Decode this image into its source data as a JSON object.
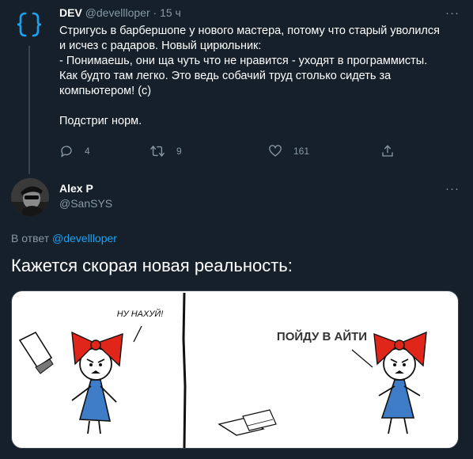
{
  "tweet": {
    "author_name": "DEV",
    "author_handle": "@devellloper",
    "separator": "·",
    "time": "15 ч",
    "more": "···",
    "lines": [
      "Стригусь в барбершопе у нового мастера, потому что старый уволился",
      "и исчез с радаров. Новый цирюльник:",
      "- Понимаешь, они ща чуть что не нравится - уходят в программисты.",
      "Как будто там легко. Это ведь собачий труд столько сидеть за",
      "компьютером! (с)",
      "",
      "Подстриг норм."
    ],
    "actions": {
      "reply_count": "4",
      "retweet_count": "9",
      "like_count": "161"
    }
  },
  "reply": {
    "author_name": "Alex P",
    "author_handle": "@SanSYS",
    "more": "···",
    "reply_to_prefix": "В ответ",
    "reply_to_handle": "@devellloper",
    "text": "Кажется скорая новая реальность:"
  },
  "comic": {
    "left_speech": "НУ НАХУЙ!",
    "right_speech": "ПОЙДУ В АЙТИ"
  },
  "colors": {
    "background": "#15202b",
    "muted": "#8899a6",
    "link": "#1da1f2",
    "divider": "#38444d",
    "bow_red": "#e0261b",
    "dress_blue": "#3e7cc8"
  }
}
